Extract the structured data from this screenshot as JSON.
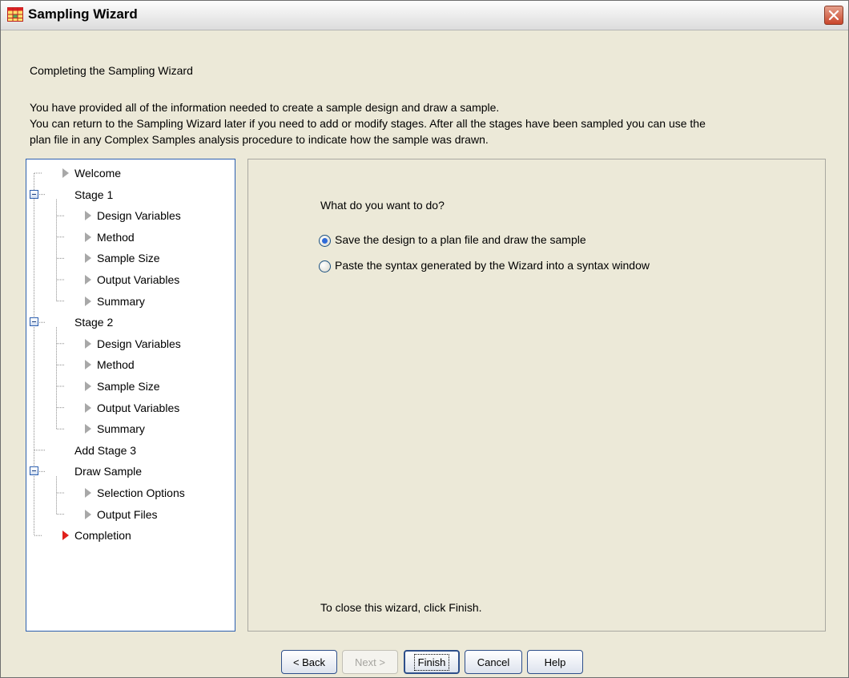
{
  "window": {
    "title": "Sampling Wizard",
    "heading": "Completing the Sampling Wizard",
    "description_lines": [
      "You have provided all of the information needed to create a sample design and draw a sample.",
      "You can return to the Sampling Wizard later if you need to add or modify stages. After all the stages have been sampled you can use the",
      "plan file in any Complex Samples analysis procedure to indicate how the sample was drawn."
    ]
  },
  "tree": {
    "items": [
      {
        "label": "Welcome",
        "level": 1,
        "kind": "step"
      },
      {
        "label": "Stage 1",
        "level": 0,
        "kind": "group"
      },
      {
        "label": "Design Variables",
        "level": 2,
        "kind": "step"
      },
      {
        "label": "Method",
        "level": 2,
        "kind": "step"
      },
      {
        "label": "Sample Size",
        "level": 2,
        "kind": "step"
      },
      {
        "label": "Output Variables",
        "level": 2,
        "kind": "step"
      },
      {
        "label": "Summary",
        "level": 2,
        "kind": "step"
      },
      {
        "label": "Stage 2",
        "level": 0,
        "kind": "group"
      },
      {
        "label": "Design Variables",
        "level": 2,
        "kind": "step"
      },
      {
        "label": "Method",
        "level": 2,
        "kind": "step"
      },
      {
        "label": "Sample Size",
        "level": 2,
        "kind": "step"
      },
      {
        "label": "Output Variables",
        "level": 2,
        "kind": "step"
      },
      {
        "label": "Summary",
        "level": 2,
        "kind": "step"
      },
      {
        "label": "Add Stage 3",
        "level": 0,
        "kind": "plain"
      },
      {
        "label": "Draw Sample",
        "level": 0,
        "kind": "group"
      },
      {
        "label": "Selection Options",
        "level": 2,
        "kind": "step"
      },
      {
        "label": "Output Files",
        "level": 2,
        "kind": "step"
      },
      {
        "label": "Completion",
        "level": 1,
        "kind": "current"
      }
    ]
  },
  "main": {
    "question": "What do you want to do?",
    "options": [
      {
        "label": "Save the design to a plan file and draw the sample",
        "checked": true
      },
      {
        "label": "Paste the syntax generated by the Wizard into a syntax window",
        "checked": false
      }
    ],
    "footnote": "To close this wizard, click Finish."
  },
  "buttons": {
    "back": "< Back",
    "next": "Next >",
    "finish": "Finish",
    "cancel": "Cancel",
    "help": "Help"
  },
  "colors": {
    "window_bg": "#ece9d8",
    "tree_border": "#2d5fae",
    "current_arrow": "#e0201b",
    "step_arrow": "#a8a8a8",
    "expander": "#2d5fae"
  }
}
